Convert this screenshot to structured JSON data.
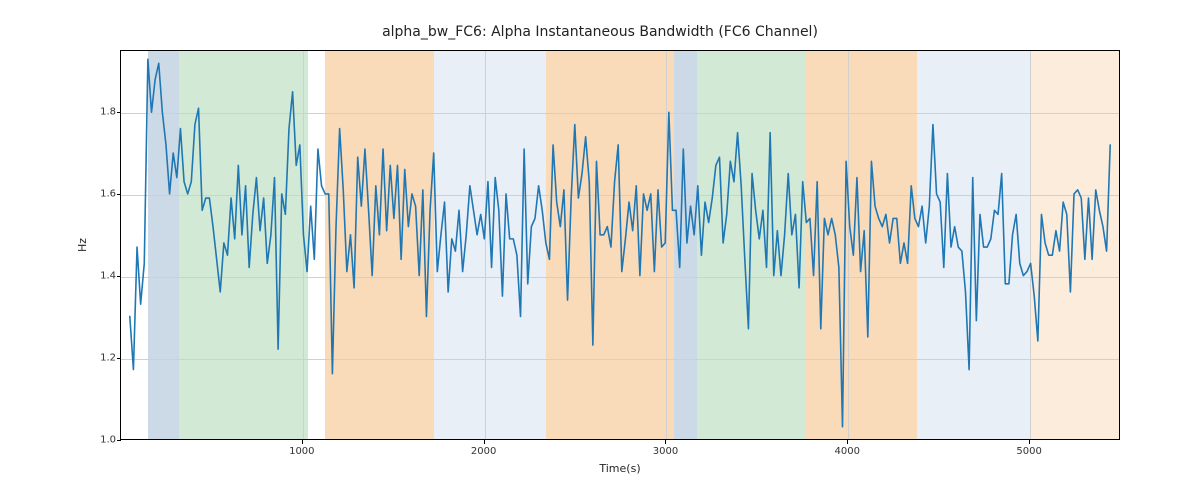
{
  "chart_data": {
    "type": "line",
    "title": "alpha_bw_FC6: Alpha Instantaneous Bandwidth (FC6 Channel)",
    "xlabel": "Time(s)",
    "ylabel": "Hz",
    "xlim": [
      0,
      5500
    ],
    "ylim": [
      1.0,
      1.95
    ],
    "xticks": [
      1000,
      2000,
      3000,
      4000,
      5000
    ],
    "yticks": [
      1.0,
      1.2,
      1.4,
      1.6,
      1.8
    ],
    "bands": [
      {
        "x0": 150,
        "x1": 320,
        "color": "#b7cadd",
        "alpha": 0.7
      },
      {
        "x0": 320,
        "x1": 1030,
        "color": "#c3e2c7",
        "alpha": 0.75
      },
      {
        "x0": 1120,
        "x1": 1720,
        "color": "#f7cfa1",
        "alpha": 0.75
      },
      {
        "x0": 1720,
        "x1": 2340,
        "color": "#dfe8f2",
        "alpha": 0.7
      },
      {
        "x0": 2340,
        "x1": 3040,
        "color": "#f7cfa1",
        "alpha": 0.75
      },
      {
        "x0": 3040,
        "x1": 3170,
        "color": "#b7cadd",
        "alpha": 0.7
      },
      {
        "x0": 3170,
        "x1": 3770,
        "color": "#c3e2c7",
        "alpha": 0.75
      },
      {
        "x0": 3770,
        "x1": 4380,
        "color": "#f7cfa1",
        "alpha": 0.75
      },
      {
        "x0": 4380,
        "x1": 5000,
        "color": "#dfe8f2",
        "alpha": 0.7
      },
      {
        "x0": 5000,
        "x1": 5500,
        "color": "#fbe4cd",
        "alpha": 0.7
      }
    ],
    "series": [
      {
        "name": "alpha_bw_FC6",
        "x_step": 20,
        "x_start": 40,
        "values": [
          1.3,
          1.17,
          1.47,
          1.33,
          1.43,
          1.93,
          1.8,
          1.88,
          1.92,
          1.8,
          1.72,
          1.6,
          1.7,
          1.64,
          1.76,
          1.63,
          1.6,
          1.63,
          1.77,
          1.81,
          1.56,
          1.59,
          1.59,
          1.52,
          1.44,
          1.36,
          1.48,
          1.45,
          1.59,
          1.49,
          1.67,
          1.5,
          1.62,
          1.42,
          1.55,
          1.64,
          1.51,
          1.59,
          1.43,
          1.5,
          1.64,
          1.22,
          1.6,
          1.55,
          1.76,
          1.85,
          1.67,
          1.72,
          1.5,
          1.41,
          1.57,
          1.44,
          1.71,
          1.62,
          1.6,
          1.6,
          1.16,
          1.52,
          1.76,
          1.61,
          1.41,
          1.5,
          1.37,
          1.69,
          1.57,
          1.71,
          1.56,
          1.4,
          1.62,
          1.5,
          1.71,
          1.51,
          1.67,
          1.54,
          1.67,
          1.44,
          1.66,
          1.52,
          1.6,
          1.57,
          1.4,
          1.61,
          1.3,
          1.56,
          1.7,
          1.41,
          1.5,
          1.58,
          1.36,
          1.49,
          1.46,
          1.56,
          1.41,
          1.5,
          1.62,
          1.56,
          1.5,
          1.55,
          1.49,
          1.63,
          1.42,
          1.64,
          1.56,
          1.35,
          1.6,
          1.49,
          1.49,
          1.45,
          1.3,
          1.71,
          1.38,
          1.52,
          1.54,
          1.62,
          1.56,
          1.48,
          1.44,
          1.72,
          1.58,
          1.52,
          1.61,
          1.34,
          1.59,
          1.77,
          1.59,
          1.65,
          1.74,
          1.63,
          1.23,
          1.68,
          1.5,
          1.5,
          1.52,
          1.47,
          1.63,
          1.72,
          1.41,
          1.49,
          1.58,
          1.51,
          1.62,
          1.4,
          1.6,
          1.56,
          1.6,
          1.41,
          1.61,
          1.47,
          1.48,
          1.8,
          1.56,
          1.56,
          1.42,
          1.71,
          1.48,
          1.57,
          1.5,
          1.62,
          1.45,
          1.58,
          1.53,
          1.59,
          1.67,
          1.69,
          1.48,
          1.55,
          1.68,
          1.63,
          1.75,
          1.62,
          1.44,
          1.27,
          1.65,
          1.56,
          1.49,
          1.56,
          1.42,
          1.75,
          1.4,
          1.51,
          1.4,
          1.5,
          1.65,
          1.5,
          1.55,
          1.37,
          1.63,
          1.53,
          1.54,
          1.4,
          1.63,
          1.27,
          1.54,
          1.5,
          1.54,
          1.5,
          1.42,
          1.03,
          1.68,
          1.52,
          1.45,
          1.64,
          1.41,
          1.51,
          1.25,
          1.68,
          1.57,
          1.54,
          1.52,
          1.55,
          1.48,
          1.54,
          1.54,
          1.43,
          1.48,
          1.43,
          1.62,
          1.54,
          1.52,
          1.57,
          1.48,
          1.57,
          1.77,
          1.6,
          1.58,
          1.42,
          1.65,
          1.47,
          1.52,
          1.47,
          1.46,
          1.36,
          1.17,
          1.64,
          1.29,
          1.55,
          1.47,
          1.47,
          1.49,
          1.56,
          1.55,
          1.65,
          1.38,
          1.38,
          1.5,
          1.55,
          1.43,
          1.4,
          1.41,
          1.43,
          1.35,
          1.24,
          1.55,
          1.48,
          1.45,
          1.45,
          1.51,
          1.46,
          1.58,
          1.55,
          1.36,
          1.6,
          1.61,
          1.59,
          1.44,
          1.59,
          1.44,
          1.61,
          1.56,
          1.52,
          1.46,
          1.72
        ]
      }
    ]
  }
}
